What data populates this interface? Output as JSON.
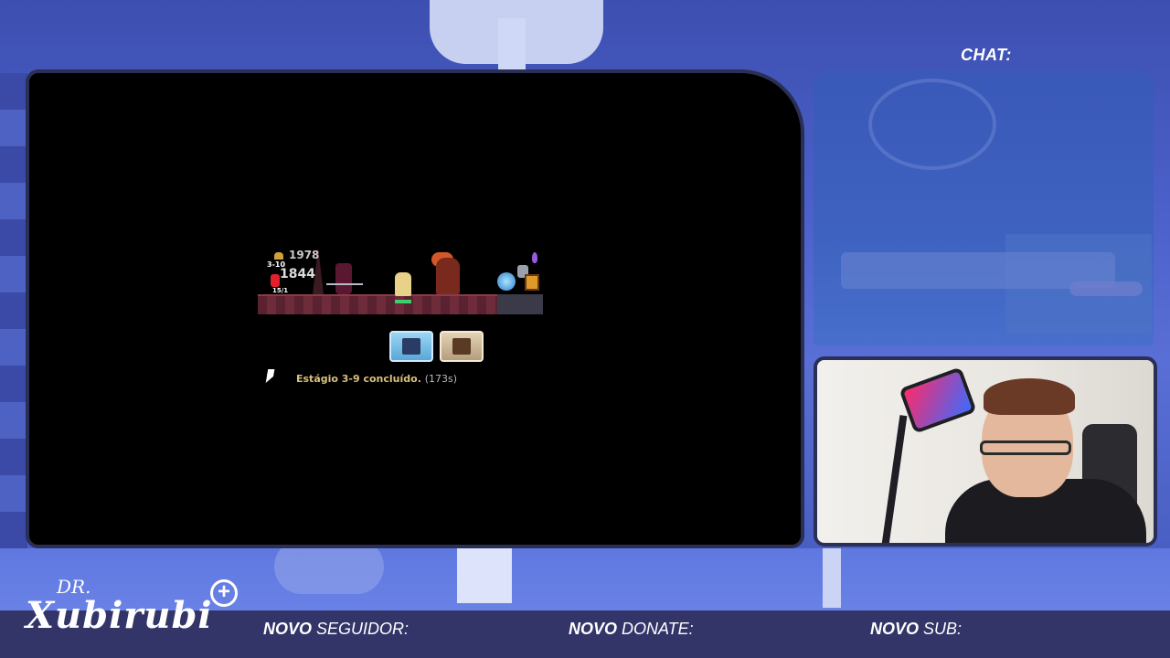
{
  "game": {
    "hud_gold": "1978",
    "hud_stage": "3-10",
    "hud_damage": "1844",
    "hud_hp": "15/1",
    "stage_message": "Estágio 3-9 concluído.",
    "stage_time": "(173s)"
  },
  "chat": {
    "label": "CHAT:"
  },
  "branding": {
    "logo_prefix": "DR.",
    "logo_name": "Xubirubi",
    "logo_plus": "+"
  },
  "alerts": {
    "follower_bold": "NOVO",
    "follower_rest": " SEGUIDOR:",
    "donate_bold": "NOVO",
    "donate_rest": " DONATE:",
    "sub_bold": "NOVO",
    "sub_rest": " SUB:"
  },
  "colors": {
    "background": "#4a5fc8",
    "bottom_bar": "#333568",
    "frame_border": "#2a2f55",
    "stage_message": "#d8c07a"
  },
  "icons": [
    "cursor-icon",
    "skill-icon-1",
    "skill-icon-2",
    "gold-icon",
    "plus-icon"
  ]
}
